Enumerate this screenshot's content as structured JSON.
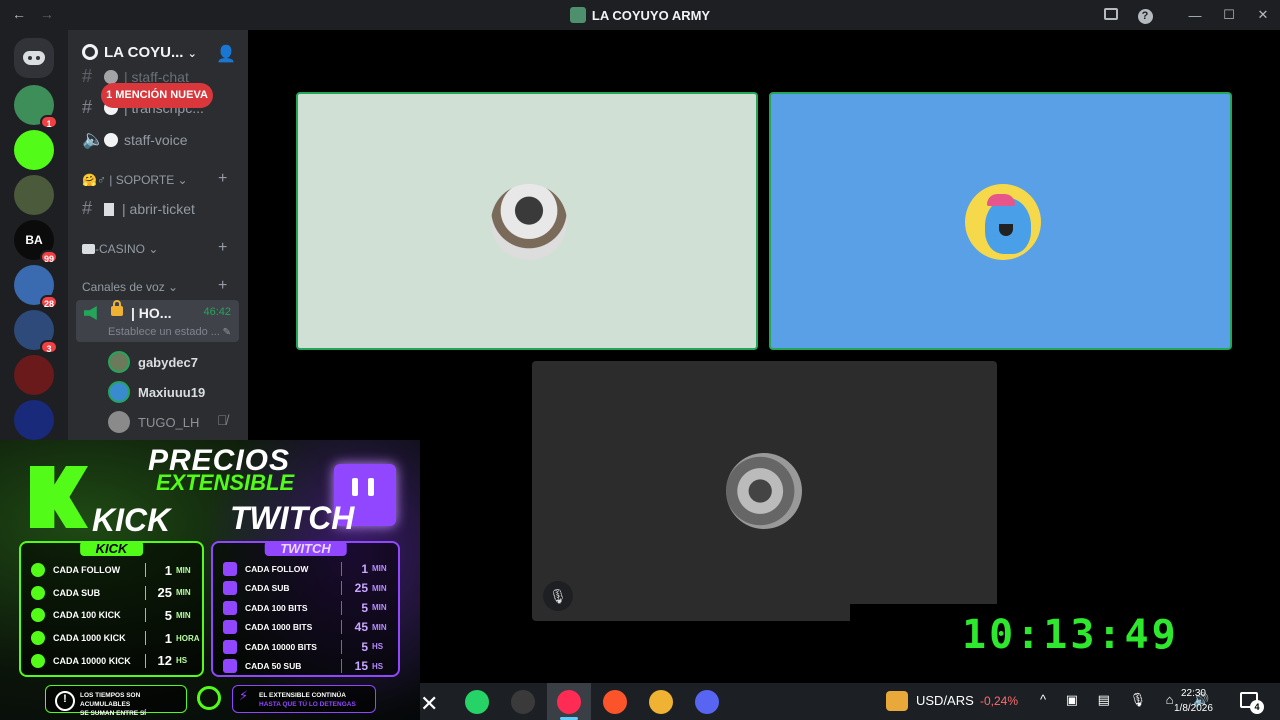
{
  "titlebar": {
    "back": "←",
    "forward": "→",
    "title": "LA COYUYO ARMY",
    "minimize": "—",
    "maximize": "☐",
    "close": "✕",
    "help": "?"
  },
  "rail": {
    "servers": [
      {
        "name": "server-1",
        "badge": "1",
        "color": "#3e8e5a"
      },
      {
        "name": "kick-server",
        "badge": "",
        "color": "#53fc18"
      },
      {
        "name": "server-3",
        "badge": "",
        "color": "#4a5a3a"
      },
      {
        "name": "ba-server",
        "badge": "99",
        "color": "#0b0b0b",
        "label": "BA"
      },
      {
        "name": "server-5",
        "badge": "28",
        "color": "#3a6ab0"
      },
      {
        "name": "guardians-server",
        "badge": "3",
        "color": "#2d4a7a"
      },
      {
        "name": "server-7",
        "badge": "",
        "color": "#6a1a1a"
      },
      {
        "name": "server-8",
        "badge": "",
        "color": "#1a2a7a"
      }
    ]
  },
  "sidebar": {
    "server_name": "LA COYU...",
    "mention_pill": "1 MENCIÓN NUEVA",
    "channels": {
      "staff_chat": "| staff-chat",
      "transcripts": "| transcripc...",
      "staff_voice": "staff-voice",
      "soporte_cat": "| SOPORTE",
      "soporte_icons": "🤗♂",
      "abrir_ticket": "| abrir-ticket",
      "casino_cat": "-CASINO",
      "voice_cat": "Canales de voz"
    },
    "voice_channel": {
      "name": "| HO...",
      "time": "46:42",
      "status": "Establece un estado ..."
    },
    "members": [
      {
        "name": "gabydec7",
        "color": "#6a7a5a"
      },
      {
        "name": "Maxiuuu19",
        "color": "#3a8ad0"
      },
      {
        "name": "TUGO_LH",
        "color": "#8a8a8a"
      }
    ]
  },
  "clock": "10:13:49",
  "overlay": {
    "title_line1": "PRECIOS",
    "title_line2": "EXTENSIBLE",
    "kick_word": "KICK",
    "twitch_word": "TWITCH",
    "kick_panel": {
      "title": "KICK",
      "rows": [
        {
          "label": "CADA FOLLOW",
          "num": "1",
          "unit": "MIN"
        },
        {
          "label": "CADA SUB",
          "num": "25",
          "unit": "MIN"
        },
        {
          "label": "CADA 100 KICK",
          "num": "5",
          "unit": "MIN"
        },
        {
          "label": "CADA 1000 KICK",
          "num": "1",
          "unit": "HORA"
        },
        {
          "label": "CADA 10000 KICK",
          "num": "12",
          "unit": "HS"
        }
      ]
    },
    "twitch_panel": {
      "title": "TWITCH",
      "rows": [
        {
          "label": "CADA FOLLOW",
          "num": "1",
          "unit": "MIN"
        },
        {
          "label": "CADA SUB",
          "num": "25",
          "unit": "MIN"
        },
        {
          "label": "CADA 100 BITS",
          "num": "5",
          "unit": "MIN"
        },
        {
          "label": "CADA 1000 BITS",
          "num": "45",
          "unit": "MIN"
        },
        {
          "label": "CADA 10000 BITS",
          "num": "5",
          "unit": "HS"
        },
        {
          "label": "CADA 50 SUB",
          "num": "15",
          "unit": "HS"
        }
      ]
    },
    "note_left": {
      "line1": "LOS TIEMPOS SON ACUMULABLES",
      "line2": "SE SUMAN ENTRE SÍ"
    },
    "note_right": {
      "line1": "EL EXTENSIBLE CONTINÚA",
      "line2": "HASTA QUE TÚ LO DETENGAS"
    }
  },
  "taskbar": {
    "apps": [
      {
        "name": "xbox",
        "color": "#ffffff"
      },
      {
        "name": "whatsapp",
        "color": "#25d366"
      },
      {
        "name": "obs",
        "color": "#3a3a3a"
      },
      {
        "name": "tiktok",
        "color": "#fe2c55"
      },
      {
        "name": "brave",
        "color": "#fb542b"
      },
      {
        "name": "coin",
        "color": "#f0b232"
      },
      {
        "name": "discord",
        "color": "#5865f2"
      }
    ],
    "usd_label": "USD/ARS",
    "usd_change": "-0,24%",
    "time": "22:30",
    "date": "1/8/2026",
    "notif_count": "4"
  }
}
